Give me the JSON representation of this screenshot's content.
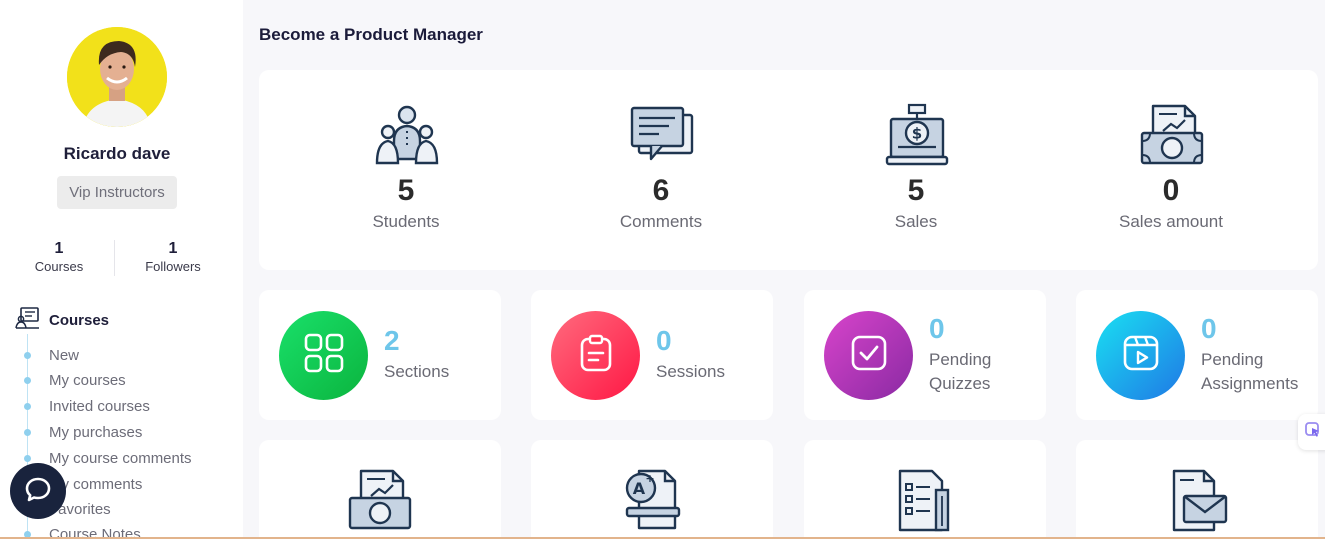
{
  "user": {
    "name": "Ricardo dave",
    "role": "Vip Instructors",
    "stats": [
      {
        "value": "1",
        "label": "Courses"
      },
      {
        "value": "1",
        "label": "Followers"
      }
    ]
  },
  "menu": {
    "heading": "Courses",
    "items": [
      "New",
      "My courses",
      "Invited courses",
      "My purchases",
      "My course comments",
      "My comments",
      "Favorites",
      "Course Notes"
    ]
  },
  "page": {
    "title": "Become a Product Manager"
  },
  "overview": [
    {
      "value": "5",
      "label": "Students",
      "icon": "students-icon"
    },
    {
      "value": "6",
      "label": "Comments",
      "icon": "comments-icon"
    },
    {
      "value": "5",
      "label": "Sales",
      "icon": "sales-icon"
    },
    {
      "value": "0",
      "label": "Sales amount",
      "icon": "sales-amount-icon"
    }
  ],
  "cards": [
    {
      "value": "2",
      "label": "Sections",
      "icon": "grid-icon",
      "color_from": "#19e06a",
      "color_to": "#0bb43e"
    },
    {
      "value": "0",
      "label": "Sessions",
      "icon": "clipboard-icon",
      "color_from": "#ff5b73",
      "color_to": "#ff1f45"
    },
    {
      "value": "0",
      "label_line1": "Pending",
      "label_line2": "Quizzes",
      "icon": "check-square-icon",
      "color_from": "#d53fc8",
      "color_to": "#8d2aa4"
    },
    {
      "value": "0",
      "label_line1": "Pending",
      "label_line2": "Assignments",
      "icon": "video-icon",
      "color_from": "#1ad9f0",
      "color_to": "#1f7ce6"
    }
  ],
  "bottom_icons": [
    "money-report-icon",
    "grade-certificate-icon",
    "checklist-icon",
    "mail-document-icon"
  ]
}
